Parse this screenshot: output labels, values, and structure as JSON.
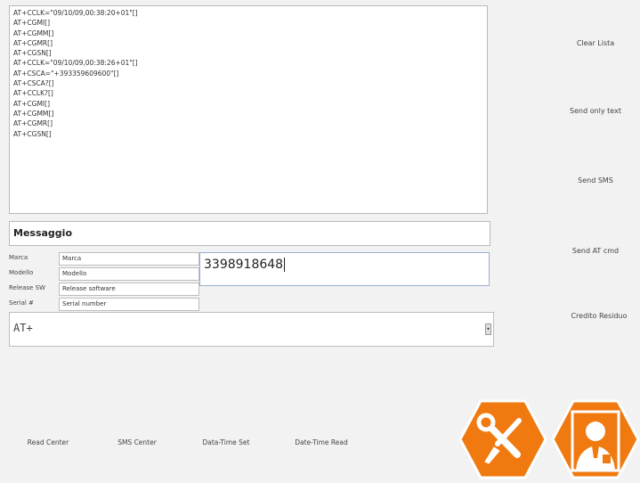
{
  "log_lines": [
    "AT+CCLK=\"09/10/09,00:38:20+01\"[]",
    "AT+CGMI[]",
    "AT+CGMM[]",
    "AT+CGMR[]",
    "AT+CGSN[]",
    "AT+CCLK=\"09/10/09,00:38:26+01\"[]",
    "AT+CSCA=\"+393359609600\"[]",
    "AT+CSCA?[]",
    "AT+CCLK?[]",
    "AT+CGMI[]",
    "AT+CGMM[]",
    "AT+CGMR[]",
    "AT+CGSN[]"
  ],
  "side_buttons": {
    "clear": "Clear Lista",
    "send_text": "Send only text",
    "send_sms": "Send SMS",
    "send_at": "Send AT cmd",
    "credito": "Credito Residuo"
  },
  "message_title": "Messaggio",
  "fields": {
    "marca_label": "Marca",
    "marca_value": "Marca",
    "modello_label": "Modello",
    "modello_value": "Modello",
    "release_label": "Release SW",
    "release_value": "Release software",
    "serial_label": "Serial #",
    "serial_value": "Serial number"
  },
  "phone_number": "3398918648",
  "at_command": "AT+",
  "bottom_buttons": {
    "read_center": "Read Center",
    "sms_center": "SMS Center",
    "date_set": "Data-Time Set",
    "date_read": "Date-Time Read"
  },
  "colors": {
    "accent_orange": "#f07a10",
    "hex_border": "#ffffff"
  },
  "icons": {
    "tools": "tools-icon",
    "user": "user-icon"
  }
}
